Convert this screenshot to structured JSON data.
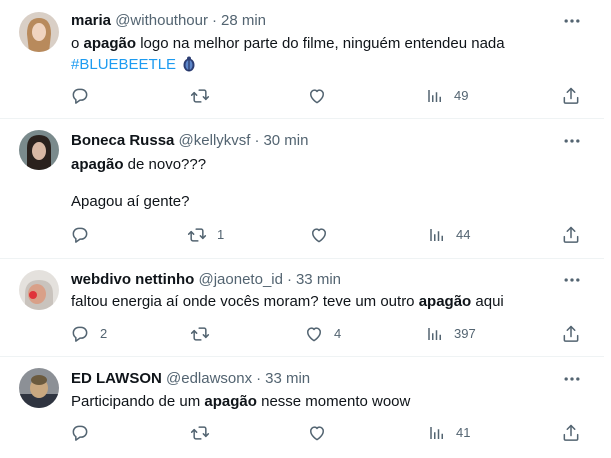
{
  "tweets": [
    {
      "name": "maria",
      "handle": "@withouthour",
      "time": "28 min",
      "text_before": "o ",
      "text_bold": "apagão",
      "text_after": " logo na melhor parte do filme, ninguém entendeu nada",
      "hashtag": "#BLUEBEETLE",
      "replies": "",
      "retweets": "",
      "likes": "",
      "views": "49"
    },
    {
      "name": "Boneca Russa",
      "handle": "@kellykvsf",
      "time": "30 min",
      "text_bold": "apagão",
      "text_after": " de novo???",
      "text_line2": "Apagou aí gente?",
      "replies": "",
      "retweets": "1",
      "likes": "",
      "views": "44"
    },
    {
      "name": "webdivo nettinho",
      "handle": "@jaoneto_id",
      "time": "33 min",
      "text_before": "faltou energia aí onde vocês moram? teve um outro ",
      "text_bold": "apagão",
      "text_after": " aqui",
      "replies": "2",
      "retweets": "",
      "likes": "4",
      "views": "397"
    },
    {
      "name": "ED LAWSON",
      "handle": "@edlawsonx",
      "time": "33 min",
      "text_before": "Participando de um ",
      "text_bold": "apagão",
      "text_after": " nesse momento woow",
      "replies": "",
      "retweets": "",
      "likes": "",
      "views": "41"
    }
  ],
  "colors": {
    "text": "#0f1419",
    "secondary": "#536471",
    "link": "#1d9bf0",
    "divider": "#eff3f4"
  },
  "icons": [
    "more-icon",
    "reply-icon",
    "retweet-icon",
    "like-icon",
    "views-icon",
    "share-icon",
    "blue-beetle-emoji-icon"
  ]
}
